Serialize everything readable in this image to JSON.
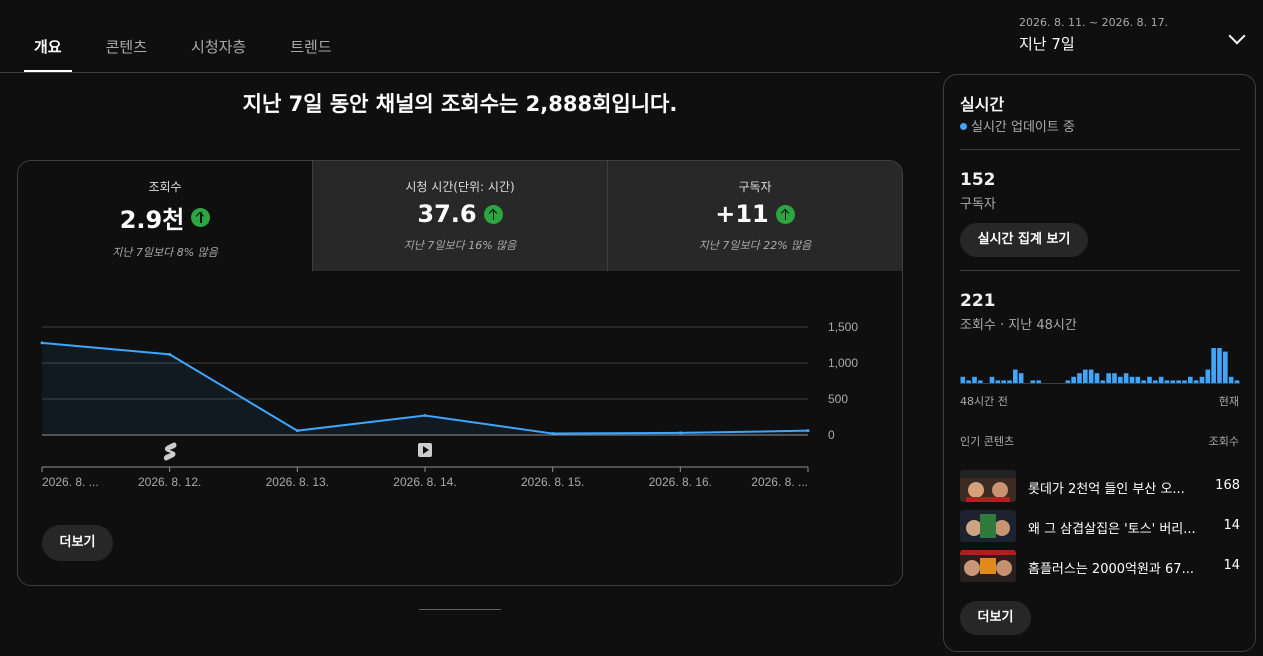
{
  "tabs": [
    {
      "label": "개요",
      "active": true
    },
    {
      "label": "콘텐츠",
      "active": false
    },
    {
      "label": "시청자층",
      "active": false
    },
    {
      "label": "트렌드",
      "active": false
    }
  ],
  "date_range": {
    "range": "2026. 8. 11. ~ 2026. 8. 17.",
    "label": "지난 7일",
    "icon": "chevron-down-icon"
  },
  "headline": "지난 7일 동안 채널의 조회수는 2,888회입니다.",
  "metrics": [
    {
      "title": "조회수",
      "value": "2.9천",
      "compare": "지난 7일보다 8% 많음",
      "trend": "up"
    },
    {
      "title": "시청 시간(단위: 시간)",
      "value": "37.6",
      "compare": "지난 7일보다 16% 많음",
      "trend": "up"
    },
    {
      "title": "구독자",
      "value": "+11",
      "compare": "지난 7일보다 22% 많음",
      "trend": "up"
    }
  ],
  "chart_data": {
    "type": "area",
    "x": [
      "2026. 8. ...",
      "2026. 8. 12.",
      "2026. 8. 13.",
      "2026. 8. 14.",
      "2026. 8. 15.",
      "2026. 8. 16.",
      "2026. 8. ..."
    ],
    "series": [
      {
        "values": [
          1280,
          1120,
          60,
          270,
          20,
          30,
          60
        ]
      }
    ],
    "y_ticks": [
      "0",
      "500",
      "1,000",
      "1,500"
    ],
    "ylim": [
      0,
      1500
    ],
    "grid": true,
    "axis_position": "right",
    "line_color": "#3ea6ff",
    "markers": [
      {
        "category_index": 1,
        "icon": "shorts-icon"
      },
      {
        "category_index": 3,
        "icon": "video-play-icon"
      }
    ]
  },
  "more_button": "더보기",
  "realtime": {
    "title": "실시간",
    "status": "실시간 업데이트 중",
    "status_color": "#3ea6ff",
    "subscribers": "152",
    "subscribers_label": "구독자",
    "realtime_button": "실시간 집계 보기",
    "views": "221",
    "views_label": "조회수 · 지난 48시간",
    "bar_start": "48시간 전",
    "bar_end": "현재",
    "bar_color": "#3ea6ff",
    "hourly_views": [
      2,
      1,
      2,
      1,
      0,
      2,
      1,
      1,
      1,
      4,
      3,
      0,
      1,
      1,
      0,
      0,
      0,
      0,
      1,
      2,
      3,
      4,
      4,
      3,
      1,
      3,
      3,
      2,
      3,
      2,
      2,
      1,
      2,
      1,
      2,
      1,
      1,
      1,
      1,
      2,
      1,
      2,
      4,
      10,
      10,
      9,
      2,
      1
    ],
    "top_content_label": "인기 콘텐츠",
    "top_content_metric": "조회수",
    "top_content": [
      {
        "title": "롯데가 2천억 들인 부산 오...",
        "views": "168"
      },
      {
        "title": "왜 그 삼겹살집은 '토스' 버리...",
        "views": "14"
      },
      {
        "title": "홈플러스는 2000억원과 67...",
        "views": "14"
      }
    ],
    "more_button": "더보기"
  }
}
